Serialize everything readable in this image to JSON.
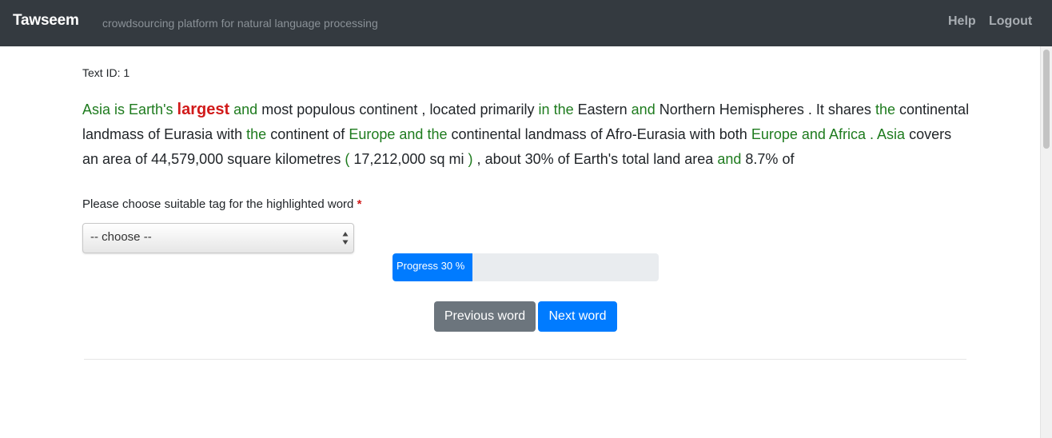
{
  "navbar": {
    "brand": "Tawseem",
    "tagline": "crowdsourcing platform for natural language processing",
    "links": {
      "help": "Help",
      "logout": "Logout"
    }
  },
  "text_id": "Text ID: 1",
  "passage": {
    "highlight_color": "#d11a1a",
    "function_word_color": "#1e7b1e",
    "words": [
      {
        "t": "Asia",
        "k": "func"
      },
      {
        "t": "is",
        "k": "func"
      },
      {
        "t": "Earth's",
        "k": "func"
      },
      {
        "t": "largest",
        "k": "hl"
      },
      {
        "t": "and",
        "k": "func"
      },
      {
        "t": "most",
        "k": ""
      },
      {
        "t": "populous",
        "k": ""
      },
      {
        "t": "continent",
        "k": ""
      },
      {
        "t": ",",
        "k": ""
      },
      {
        "t": "located",
        "k": ""
      },
      {
        "t": "primarily",
        "k": ""
      },
      {
        "t": "in",
        "k": "func"
      },
      {
        "t": "the",
        "k": "func"
      },
      {
        "t": "Eastern",
        "k": ""
      },
      {
        "t": "and",
        "k": "func"
      },
      {
        "t": "Northern",
        "k": ""
      },
      {
        "t": "Hemispheres",
        "k": ""
      },
      {
        "t": ".",
        "k": ""
      },
      {
        "t": "It",
        "k": ""
      },
      {
        "t": "shares",
        "k": ""
      },
      {
        "t": "the",
        "k": "func"
      },
      {
        "t": "continental",
        "k": ""
      },
      {
        "t": "landmass",
        "k": ""
      },
      {
        "t": "of",
        "k": ""
      },
      {
        "t": "Eurasia",
        "k": ""
      },
      {
        "t": "with",
        "k": ""
      },
      {
        "t": "the",
        "k": "func"
      },
      {
        "t": "continent",
        "k": ""
      },
      {
        "t": "of",
        "k": ""
      },
      {
        "t": "Europe",
        "k": "func"
      },
      {
        "t": "and",
        "k": "func"
      },
      {
        "t": "the",
        "k": "func"
      },
      {
        "t": "continental",
        "k": ""
      },
      {
        "t": "landmass",
        "k": ""
      },
      {
        "t": "of",
        "k": ""
      },
      {
        "t": "Afro-Eurasia",
        "k": ""
      },
      {
        "t": "with",
        "k": ""
      },
      {
        "t": "both",
        "k": ""
      },
      {
        "t": "Europe",
        "k": "func"
      },
      {
        "t": "and",
        "k": "func"
      },
      {
        "t": "Africa",
        "k": "func"
      },
      {
        "t": ".",
        "k": "func"
      },
      {
        "t": "Asia",
        "k": "func"
      },
      {
        "t": "covers",
        "k": ""
      },
      {
        "t": "an",
        "k": ""
      },
      {
        "t": "area",
        "k": ""
      },
      {
        "t": "of",
        "k": ""
      },
      {
        "t": "44,579,000",
        "k": ""
      },
      {
        "t": "square",
        "k": ""
      },
      {
        "t": "kilometres",
        "k": ""
      },
      {
        "t": "(",
        "k": "func"
      },
      {
        "t": "17,212,000",
        "k": ""
      },
      {
        "t": "sq",
        "k": ""
      },
      {
        "t": "mi",
        "k": ""
      },
      {
        "t": ")",
        "k": "func"
      },
      {
        "t": ",",
        "k": ""
      },
      {
        "t": "about",
        "k": ""
      },
      {
        "t": "30%",
        "k": ""
      },
      {
        "t": "of",
        "k": ""
      },
      {
        "t": "Earth's",
        "k": ""
      },
      {
        "t": "total",
        "k": ""
      },
      {
        "t": "land",
        "k": ""
      },
      {
        "t": "area",
        "k": ""
      },
      {
        "t": "and",
        "k": "func"
      },
      {
        "t": "8.7%",
        "k": ""
      },
      {
        "t": "of",
        "k": ""
      }
    ]
  },
  "tag_question": {
    "label": "Please choose suitable tag for the highlighted word",
    "required_mark": "*"
  },
  "tag_select": {
    "selected": "-- choose --"
  },
  "progress": {
    "label": "Progress 30 %",
    "fraction": 0.3,
    "color": "#007bff"
  },
  "buttons": {
    "previous": "Previous word",
    "next": "Next word"
  }
}
